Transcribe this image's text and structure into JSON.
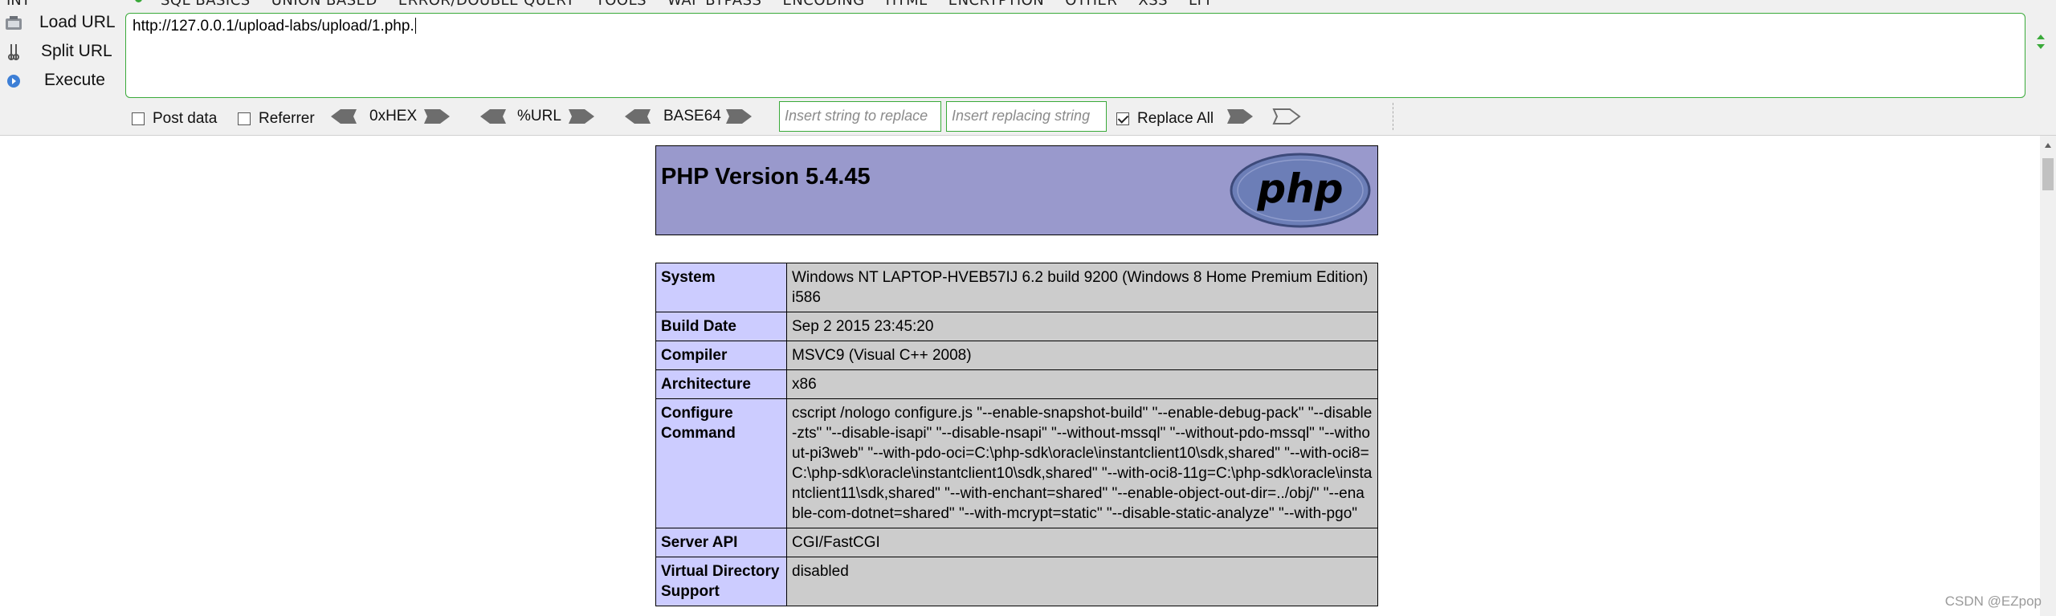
{
  "toolbar": {
    "int_label": "INT",
    "menu": [
      "SQL BASICS",
      "UNION BASED",
      "ERROR/DOUBLE QUERY",
      "TOOLS",
      "WAF BYPASS",
      "ENCODING",
      "HTML",
      "ENCRYPTION",
      "OTHER",
      "XSS",
      "LFI"
    ],
    "load_url": "Load URL",
    "split_url": "Split URL",
    "execute": "Execute",
    "url_value": "http://127.0.0.1/upload-labs/upload/1.php.",
    "post_data": "Post data",
    "post_data_checked": false,
    "referrer": "Referrer",
    "referrer_checked": false,
    "hex": "0xHEX",
    "url_enc": "%URL",
    "base64": "BASE64",
    "find_placeholder": "Insert string to replace",
    "replace_placeholder": "Insert replacing string",
    "replace_all": "Replace All",
    "replace_all_checked": true
  },
  "phpinfo": {
    "title": "PHP Version 5.4.45",
    "logo_text": "php",
    "rows": [
      {
        "key": "System",
        "value": "Windows NT LAPTOP-HVEB57IJ 6.2 build 9200 (Windows 8 Home Premium Edition) i586"
      },
      {
        "key": "Build Date",
        "value": "Sep 2 2015 23:45:20"
      },
      {
        "key": "Compiler",
        "value": "MSVC9 (Visual C++ 2008)"
      },
      {
        "key": "Architecture",
        "value": "x86"
      },
      {
        "key": "Configure Command",
        "value": "cscript /nologo configure.js \"--enable-snapshot-build\" \"--enable-debug-pack\" \"--disable-zts\" \"--disable-isapi\" \"--disable-nsapi\" \"--without-mssql\" \"--without-pdo-mssql\" \"--without-pi3web\" \"--with-pdo-oci=C:\\php-sdk\\oracle\\instantclient10\\sdk,shared\" \"--with-oci8=C:\\php-sdk\\oracle\\instantclient10\\sdk,shared\" \"--with-oci8-11g=C:\\php-sdk\\oracle\\instantclient11\\sdk,shared\" \"--with-enchant=shared\" \"--enable-object-out-dir=../obj/\" \"--enable-com-dotnet=shared\" \"--with-mcrypt=static\" \"--disable-static-analyze\" \"--with-pgo\""
      },
      {
        "key": "Server API",
        "value": "CGI/FastCGI"
      },
      {
        "key": "Virtual Directory Support",
        "value": "disabled"
      }
    ]
  },
  "watermark": "CSDN @EZpop",
  "colors": {
    "accent_green": "#3aaa3a",
    "php_header": "#9999cc",
    "key_cell": "#ccccff",
    "value_cell": "#cccccc"
  }
}
